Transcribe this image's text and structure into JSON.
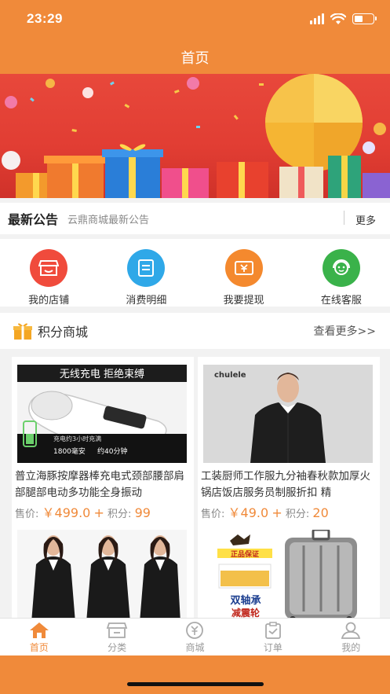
{
  "status_bar": {
    "time": "23:29"
  },
  "nav": {
    "title": "首页"
  },
  "notice": {
    "label": "最新公告",
    "text": "云鼎商城最新公告",
    "more": "更多"
  },
  "quick_actions": [
    {
      "label": "我的店铺",
      "icon": "store-icon",
      "color": "#f04b3c"
    },
    {
      "label": "消费明细",
      "icon": "list-icon",
      "color": "#2fa8e8"
    },
    {
      "label": "我要提现",
      "icon": "withdraw-icon",
      "color": "#f4892e"
    },
    {
      "label": "在线客服",
      "icon": "service-icon",
      "color": "#3ab24a"
    }
  ],
  "points_mall": {
    "title": "积分商城",
    "more": "查看更多>>"
  },
  "products": [
    {
      "name": "普立海豚按摩器棒充电式颈部腰部肩部腿部电动多功能全身振动",
      "price_label": "售价:",
      "price": "￥499.0",
      "plus": "+",
      "points_label": "积分:",
      "points": "99",
      "image_text": [
        "无线充电 拒绝束缚",
        "充电约3小时充满",
        "1800毫安",
        "约40分钟"
      ]
    },
    {
      "name": "工装厨师工作服九分袖春秋款加厚火锅店饭店服务员制服折扣 精",
      "price_label": "售价:",
      "price": "￥49.0",
      "plus": "+",
      "points_label": "积分:",
      "points": "20",
      "image_text": [
        "chulele"
      ]
    },
    {
      "name": "",
      "image_text": []
    },
    {
      "name": "",
      "image_text": [
        "正品保证",
        "双轴承",
        "减震轮"
      ]
    }
  ],
  "tabs": [
    {
      "label": "首页",
      "icon": "home-icon",
      "active": true
    },
    {
      "label": "分类",
      "icon": "category-icon",
      "active": false
    },
    {
      "label": "商城",
      "icon": "mall-icon",
      "active": false
    },
    {
      "label": "订单",
      "icon": "order-icon",
      "active": false
    },
    {
      "label": "我的",
      "icon": "profile-icon",
      "active": false
    }
  ],
  "colors": {
    "primary": "#f08a3a",
    "banner": "#e13d33"
  }
}
